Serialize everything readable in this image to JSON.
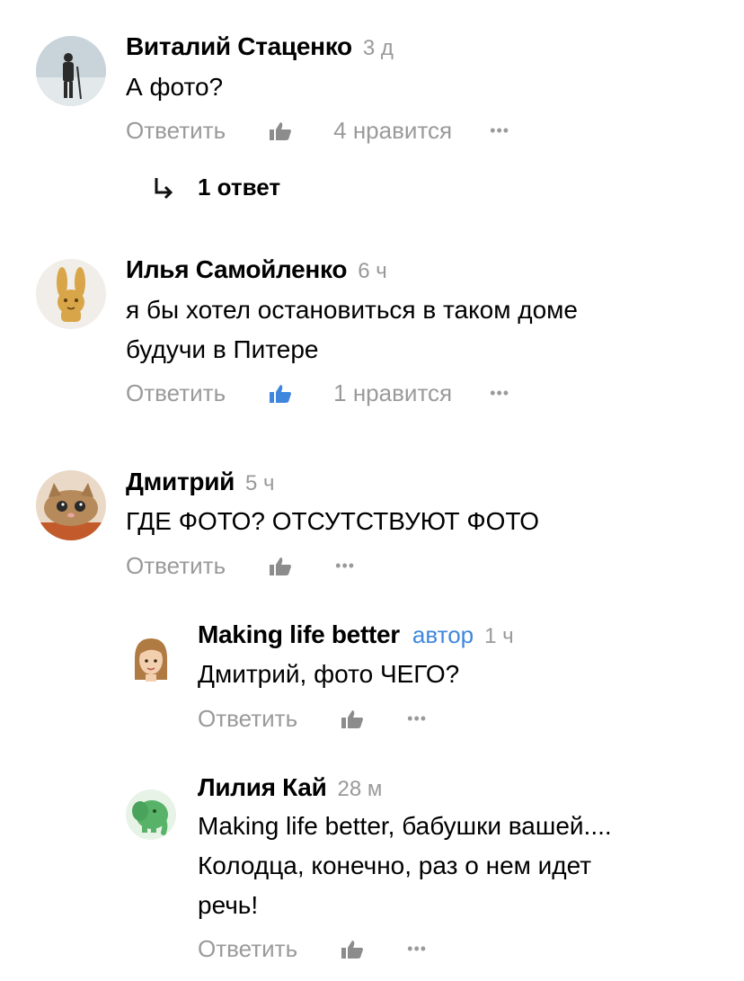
{
  "comments": [
    {
      "author": "Виталий Стаценко",
      "time": "3 д",
      "text": "А фото?",
      "reply_label": "Ответить",
      "likes_label": "4 нравится",
      "more": "•••",
      "avatar": "photo-person-on-ice"
    },
    {
      "author": "Илья Самойленко",
      "time": "6 ч",
      "text_lines": [
        "я бы хотел остановиться в таком доме",
        "будучи в Питере"
      ],
      "reply_label": "Ответить",
      "likes_label": "1 нравится",
      "more": "•••",
      "liked": true,
      "avatar": "rabbit-avatar"
    },
    {
      "author": "Дмитрий",
      "time": "5 ч",
      "text": "ГДЕ ФОТО? ОТСУТСТВУЮТ ФОТО",
      "reply_label": "Ответить",
      "more": "•••",
      "avatar": "cat-photo"
    },
    {
      "author": "Making life better",
      "badge": "автор",
      "time": "1 ч",
      "text": "Дмитрий, фото ЧЕГО?",
      "reply_label": "Ответить",
      "more": "•••",
      "avatar": "girl-memoji"
    },
    {
      "author": "Лилия Кай",
      "time": "28 м",
      "text_lines": [
        "Making life better, бабушки вашей....",
        "Колодца, конечно, раз о нем идет",
        "речь!"
      ],
      "reply_label": "Ответить",
      "more": "•••",
      "avatar": "elephant-avatar"
    }
  ],
  "thread": {
    "label": "1 ответ",
    "icon": "reply-arrow-icon"
  },
  "colors": {
    "accent": "#3f87dc",
    "muted": "#9a9a9a",
    "like_active": "#3f87dc",
    "like_inactive": "#8c8c8c"
  }
}
